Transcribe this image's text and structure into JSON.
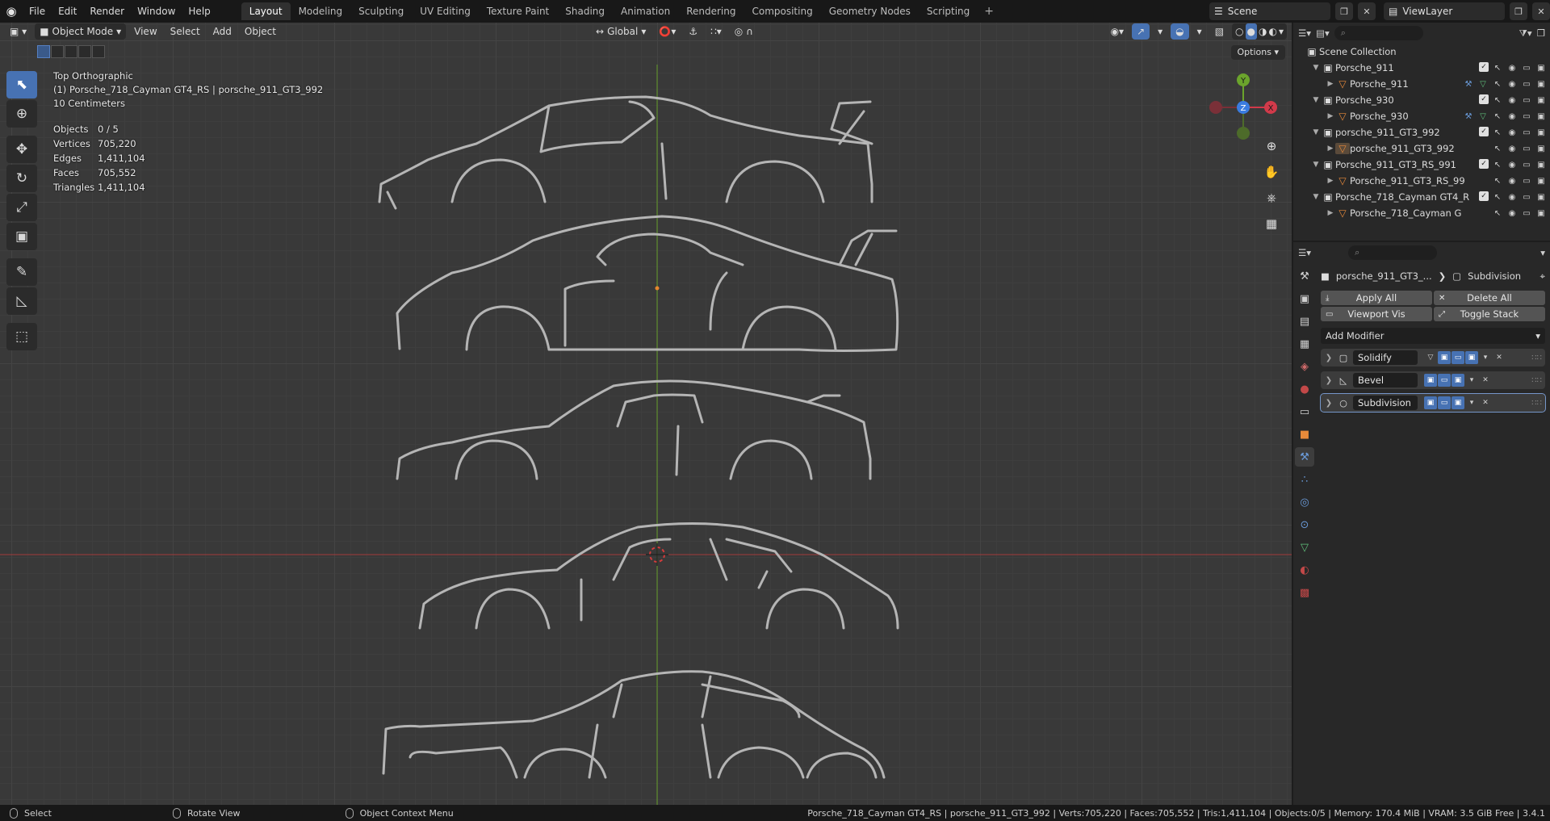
{
  "topbar": {
    "menu": [
      "File",
      "Edit",
      "Render",
      "Window",
      "Help"
    ],
    "workspaces": [
      "Layout",
      "Modeling",
      "Sculpting",
      "UV Editing",
      "Texture Paint",
      "Shading",
      "Animation",
      "Rendering",
      "Compositing",
      "Geometry Nodes",
      "Scripting"
    ],
    "active_workspace": "Layout",
    "add_label": "+",
    "scene": "Scene",
    "view_layer": "ViewLayer"
  },
  "viewport": {
    "mode": "Object Mode",
    "menus": [
      "View",
      "Select",
      "Add",
      "Object"
    ],
    "transform_orientation": "Global",
    "options_label": "Options",
    "view_name": "Top Orthographic",
    "active_object_line": "(1) Porsche_718_Cayman GT4_RS | porsche_911_GT3_992",
    "grid_scale": "10 Centimeters",
    "stats": [
      {
        "k": "Objects",
        "v": "0 / 5"
      },
      {
        "k": "Vertices",
        "v": "705,220"
      },
      {
        "k": "Edges",
        "v": "1,411,104"
      },
      {
        "k": "Faces",
        "v": "705,552"
      },
      {
        "k": "Triangles",
        "v": "1,411,104"
      }
    ],
    "gizmo": {
      "x": "X",
      "y": "Y",
      "z": "Z"
    },
    "colors": {
      "x_axis": "#d13a4a",
      "y_axis": "#6ba42c",
      "z_axis": "#3a7ce0",
      "active_tool": "#4772b3",
      "line_art": "#b5b5b5"
    }
  },
  "outliner": {
    "search_placeholder": "",
    "root": "Scene Collection",
    "items": [
      {
        "label": "Porsche_911",
        "type": "collection"
      },
      {
        "label": "Porsche_911",
        "type": "object"
      },
      {
        "label": "Porsche_930",
        "type": "collection"
      },
      {
        "label": "Porsche_930",
        "type": "object"
      },
      {
        "label": "porsche_911_GT3_992",
        "type": "collection"
      },
      {
        "label": "porsche_911_GT3_992",
        "type": "object"
      },
      {
        "label": "Porsche_911_GT3_RS_991",
        "type": "collection"
      },
      {
        "label": "Porsche_911_GT3_RS_99",
        "type": "object"
      },
      {
        "label": "Porsche_718_Cayman GT4_R",
        "type": "collection"
      },
      {
        "label": "Porsche_718_Cayman G",
        "type": "object"
      }
    ]
  },
  "properties": {
    "object_name": "porsche_911_GT3_...",
    "modifier_context": "Subdivision",
    "apply_all": "Apply All",
    "delete_all": "Delete All",
    "viewport_vis": "Viewport Vis",
    "toggle_stack": "Toggle Stack",
    "add_modifier": "Add Modifier",
    "modifiers": [
      "Solidify",
      "Bevel",
      "Subdivision"
    ]
  },
  "statusbar": {
    "select": "Select",
    "rotate": "Rotate View",
    "context": "Object Context Menu",
    "info": "Porsche_718_Cayman GT4_RS | porsche_911_GT3_992 | Verts:705,220 | Faces:705,552 | Tris:1,411,104 | Objects:0/5 | Memory: 170.4 MiB | VRAM: 3.5 GiB Free | 3.4.1"
  }
}
